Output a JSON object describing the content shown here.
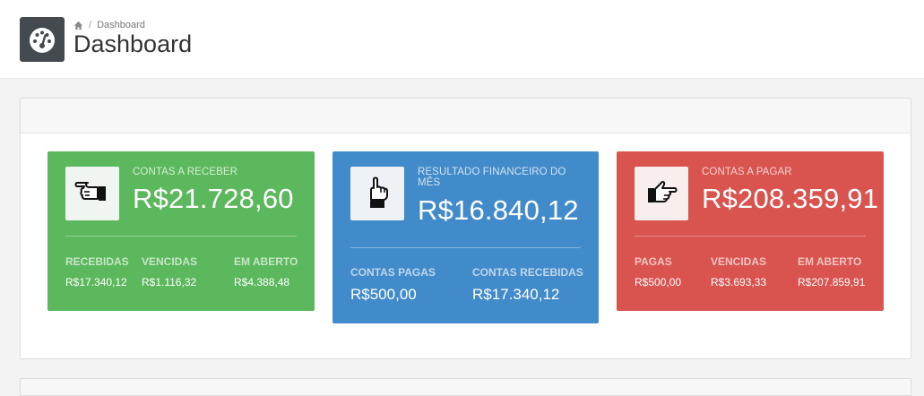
{
  "header": {
    "breadcrumb": {
      "current": "Dashboard",
      "separator": "/"
    },
    "title": "Dashboard",
    "icon": "dashboard-gauge-icon"
  },
  "cards": {
    "receber": {
      "color": "#5cb85c",
      "icon": "hand-pointing-left-icon",
      "label": "CONTAS A RECEBER",
      "value": "R$21.728,60",
      "stats": [
        {
          "label": "RECEBIDAS",
          "value": "R$17.340,12"
        },
        {
          "label": "VENCIDAS",
          "value": "R$1.116,32"
        },
        {
          "label": "EM ABERTO",
          "value": "R$4.388,48"
        }
      ]
    },
    "resultado": {
      "color": "#428bca",
      "icon": "hand-pointing-up-icon",
      "label": "RESULTADO FINANCEIRO DO MÊS",
      "value": "R$16.840,12",
      "stats": [
        {
          "label": "CONTAS PAGAS",
          "value": "R$500,00"
        },
        {
          "label": "CONTAS RECEBIDAS",
          "value": "R$17.340,12"
        }
      ]
    },
    "pagar": {
      "color": "#d9534f",
      "icon": "hand-pointing-right-icon",
      "label": "CONTAS A PAGAR",
      "value": "R$208.359,91",
      "stats": [
        {
          "label": "PAGAS",
          "value": "R$500,00"
        },
        {
          "label": "VENCIDAS",
          "value": "R$3.693,33"
        },
        {
          "label": "EM ABERTO",
          "value": "R$207.859,91"
        }
      ]
    }
  }
}
